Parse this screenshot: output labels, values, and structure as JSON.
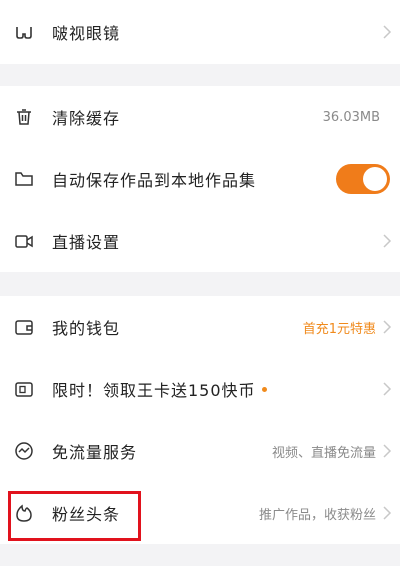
{
  "sections": [
    {
      "rows": [
        {
          "icon": "glasses-icon",
          "label": "啵视眼镜",
          "value": "",
          "chevron": true
        }
      ]
    },
    {
      "rows": [
        {
          "icon": "trash-icon",
          "label": "清除缓存",
          "value": "36.03MB",
          "chevron": false
        },
        {
          "icon": "folder-icon",
          "label": "自动保存作品到本地作品集",
          "toggle": true
        },
        {
          "icon": "live-camera-icon",
          "label": "直播设置",
          "value": "",
          "chevron": true
        }
      ]
    },
    {
      "rows": [
        {
          "icon": "wallet-icon",
          "label": "我的钱包",
          "value": "首充1元特惠",
          "chevron": true
        },
        {
          "icon": "sim-card-icon",
          "label": "限时！领取王卡送150快币",
          "value": "",
          "chevron": true,
          "dot": true
        },
        {
          "icon": "data-free-icon",
          "label": "免流量服务",
          "value": "视频、直播免流量",
          "chevron": true
        },
        {
          "icon": "fan-headline-icon",
          "label": "粉丝头条",
          "value": "推广作品，收获粉丝",
          "chevron": true
        }
      ]
    }
  ],
  "colors": {
    "accent": "#f08a1c",
    "toggle_on": "#f07c1a",
    "highlight_border": "#e1121d",
    "background": "#f3f3f5"
  }
}
